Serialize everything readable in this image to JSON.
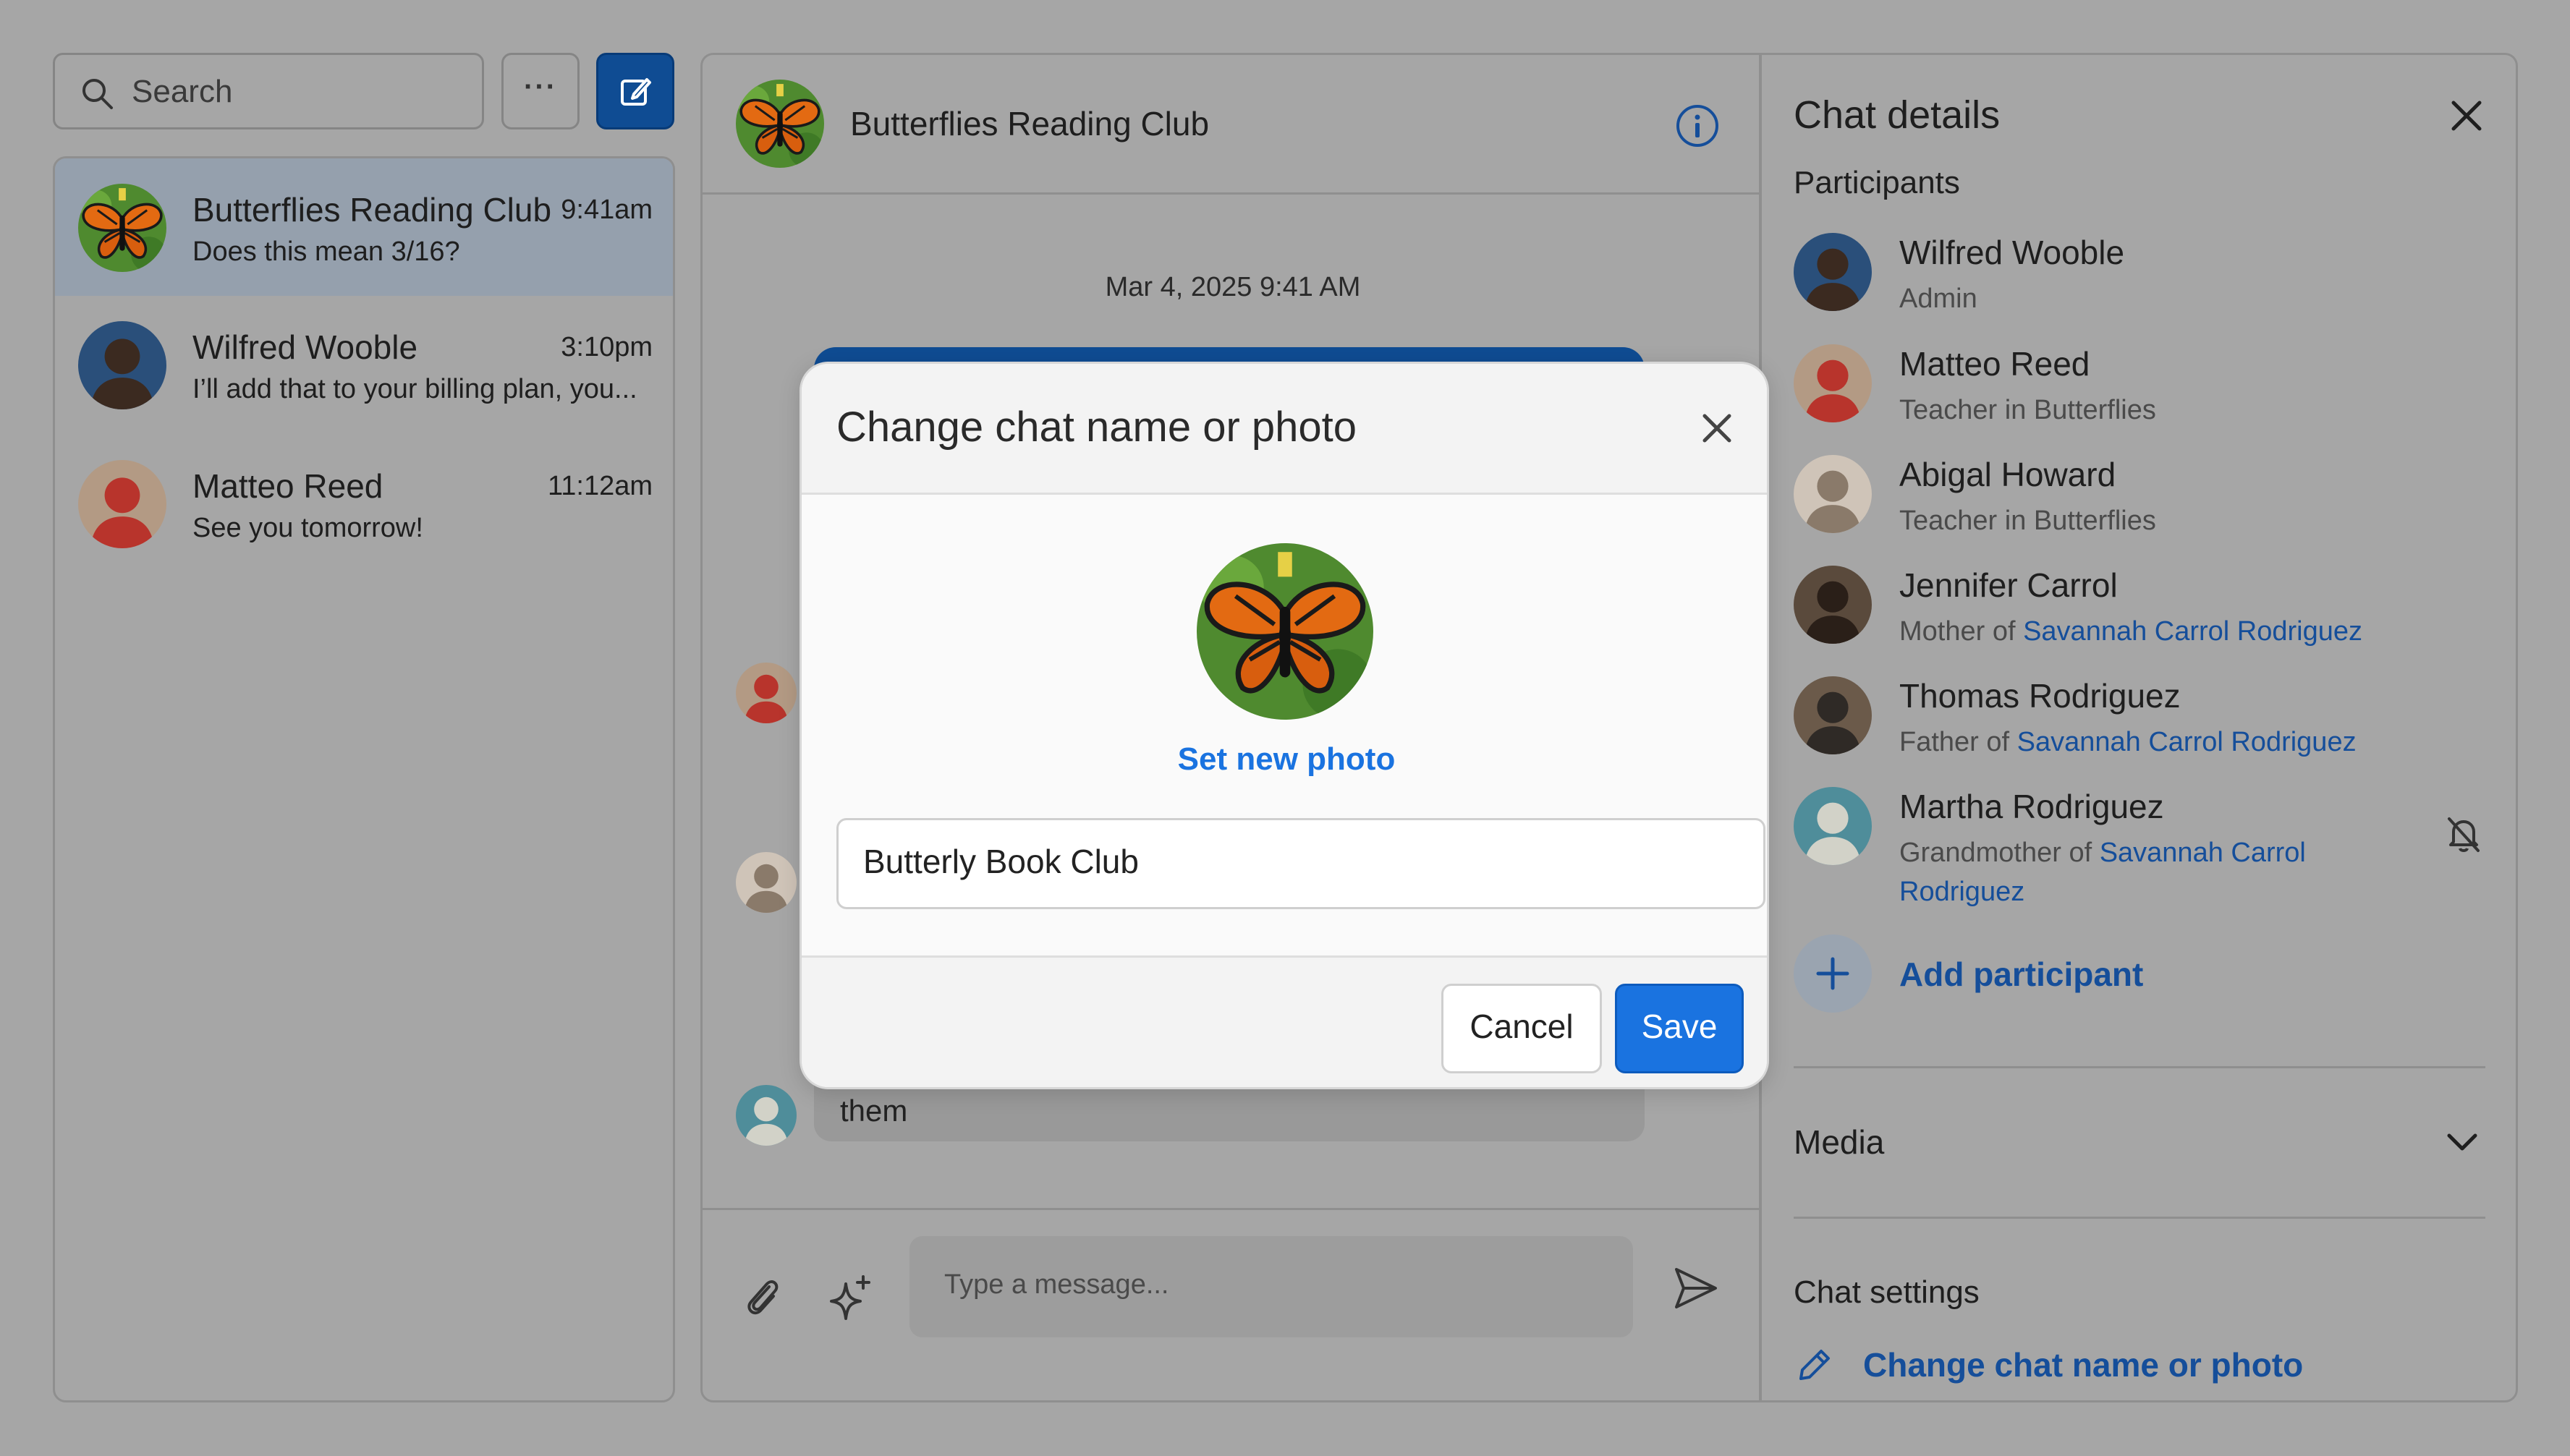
{
  "search": {
    "placeholder": "Search"
  },
  "toolbar": {
    "more_label": "···"
  },
  "conversations": [
    {
      "name": "Butterflies Reading Club",
      "time": "9:41am",
      "preview": "Does this mean 3/16?"
    },
    {
      "name": "Wilfred Wooble",
      "time": "3:10pm",
      "preview": "I’ll add that to your billing plan, you..."
    },
    {
      "name": "Matteo Reed",
      "time": "11:12am",
      "preview": "See you tomorrow!"
    }
  ],
  "chat": {
    "title": "Butterflies Reading Club",
    "date_stamp": "Mar 4, 2025 9:41 AM",
    "partial_message": "them",
    "composer_placeholder": "Type a message..."
  },
  "details": {
    "title": "Chat details",
    "participants_heading": "Participants",
    "participants": [
      {
        "name": "Wilfred Wooble",
        "role": "Admin",
        "link": ""
      },
      {
        "name": "Matteo Reed",
        "role": "Teacher in Butterflies",
        "link": ""
      },
      {
        "name": "Abigal Howard",
        "role": "Teacher in Butterflies",
        "link": ""
      },
      {
        "name": "Jennifer Carrol",
        "role": "Mother of ",
        "link": "Savannah Carrol Rodriguez"
      },
      {
        "name": "Thomas Rodriguez",
        "role": "Father of ",
        "link": "Savannah Carrol Rodriguez"
      },
      {
        "name": "Martha Rodriguez",
        "role": "Grandmother of ",
        "link": "Savannah Carrol Rodriguez"
      }
    ],
    "add_participant": "Add participant",
    "media": "Media",
    "chat_settings": "Chat settings",
    "change_name": "Change chat name or photo"
  },
  "modal": {
    "title": "Change chat name or photo",
    "set_photo": "Set new photo",
    "name_value": "Butterly Book Club",
    "cancel": "Cancel",
    "save": "Save"
  },
  "colors": {
    "overlay": "#a6a6a6",
    "primary": "#1a73e0",
    "link": "#154e9a",
    "selected_row": "#95a0ad"
  },
  "icons": [
    "search-icon",
    "more-icon",
    "compose-icon",
    "info-icon",
    "close-icon",
    "attach-icon",
    "sparkle-icon",
    "send-icon",
    "bell-off-icon",
    "plus-icon",
    "chevron-down-icon",
    "pencil-icon"
  ]
}
